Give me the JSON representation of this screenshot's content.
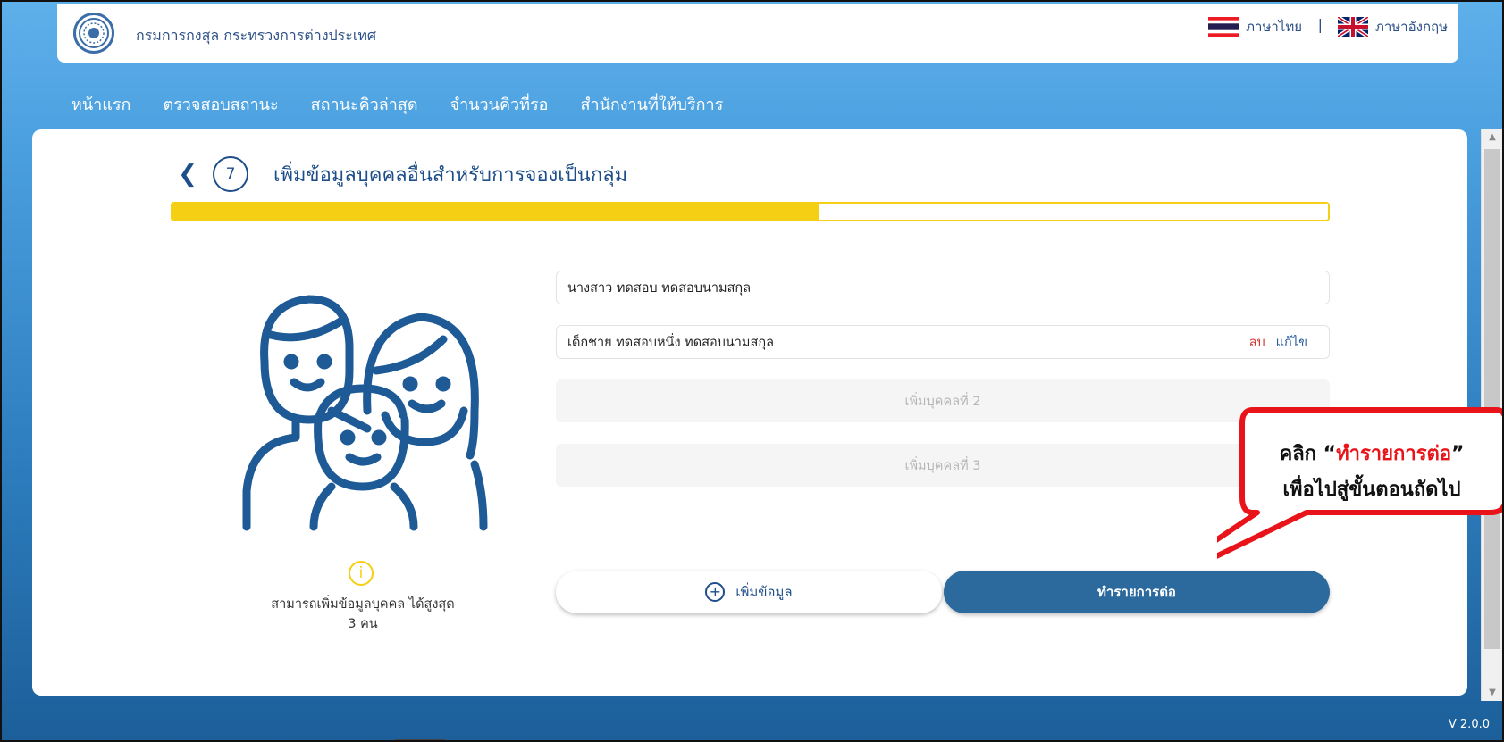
{
  "header": {
    "org_name": "กรมการกงสุล กระทรวงการต่างประเทศ",
    "lang_thai": "ภาษาไทย",
    "lang_separator": "|",
    "lang_english": "ภาษาอังกฤษ"
  },
  "nav": {
    "items": [
      "หน้าแรก",
      "ตรวจสอบสถานะ",
      "สถานะคิวล่าสุด",
      "จำนวนคิวที่รอ",
      "สำนักงานที่ให้บริการ"
    ]
  },
  "page": {
    "step_number": "7",
    "title": "เพิ่มข้อมูลบุคคลอื่นสำหรับการจองเป็นกลุ่ม",
    "progress_fraction": 0.56
  },
  "info": {
    "line1": "สามารถเพิ่มข้อมูลบุคคล ได้สูงสุด",
    "line2": "3 คน"
  },
  "persons": [
    {
      "name": "นางสาว ทดสอบ  ทดสอบนามสกุล"
    },
    {
      "name": "เด็กชาย ทดสอบหนึ่ง  ทดสอบนามสกุล",
      "delete_label": "ลบ",
      "edit_label": "แก้ไข"
    }
  ],
  "slots": [
    "เพิ่มบุคคลที่ 2",
    "เพิ่มบุคคลที่ 3"
  ],
  "buttons": {
    "add_label": "เพิ่มข้อมูล",
    "continue_label": "ทำรายการต่อ"
  },
  "callout": {
    "prefix": "คลิก “",
    "highlight": "ทำรายการต่อ",
    "suffix": "”",
    "line2": "เพื่อไปสู่ขั้นตอนถัดไป"
  },
  "footer": {
    "version": "V 2.0.0"
  },
  "colors": {
    "primary": "#1d4e89",
    "accent_yellow": "#f5cf14",
    "button_blue": "#2c6a9e",
    "delete_red": "#d0322e",
    "callout_red": "#e8141a"
  }
}
